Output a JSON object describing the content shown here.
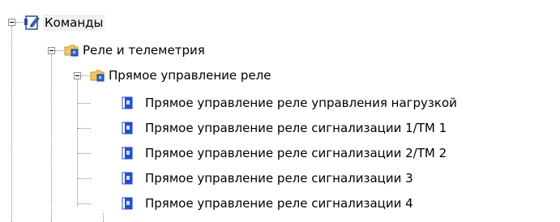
{
  "tree": {
    "root": {
      "label": "Команды",
      "icon": "commands-folder-icon"
    },
    "group": {
      "label": "Реле и телеметрия",
      "icon": "folder-icon"
    },
    "subgroup": {
      "label": "Прямое управление реле",
      "icon": "folder-icon"
    },
    "commands": [
      {
        "label": "Прямое управление реле управления нагрузкой",
        "icon": "command-icon"
      },
      {
        "label": "Прямое управление реле сигнализации 1/ТМ 1",
        "icon": "command-icon"
      },
      {
        "label": "Прямое управление реле сигнализации 2/ТМ 2",
        "icon": "command-icon"
      },
      {
        "label": "Прямое управление реле сигнализации 3",
        "icon": "command-icon"
      },
      {
        "label": "Прямое управление реле сигнализации 4",
        "icon": "command-icon"
      }
    ]
  },
  "colors": {
    "connector": "#8a8a8a",
    "folder": "#f5c75a",
    "command_icon": "#1f4fd6"
  }
}
